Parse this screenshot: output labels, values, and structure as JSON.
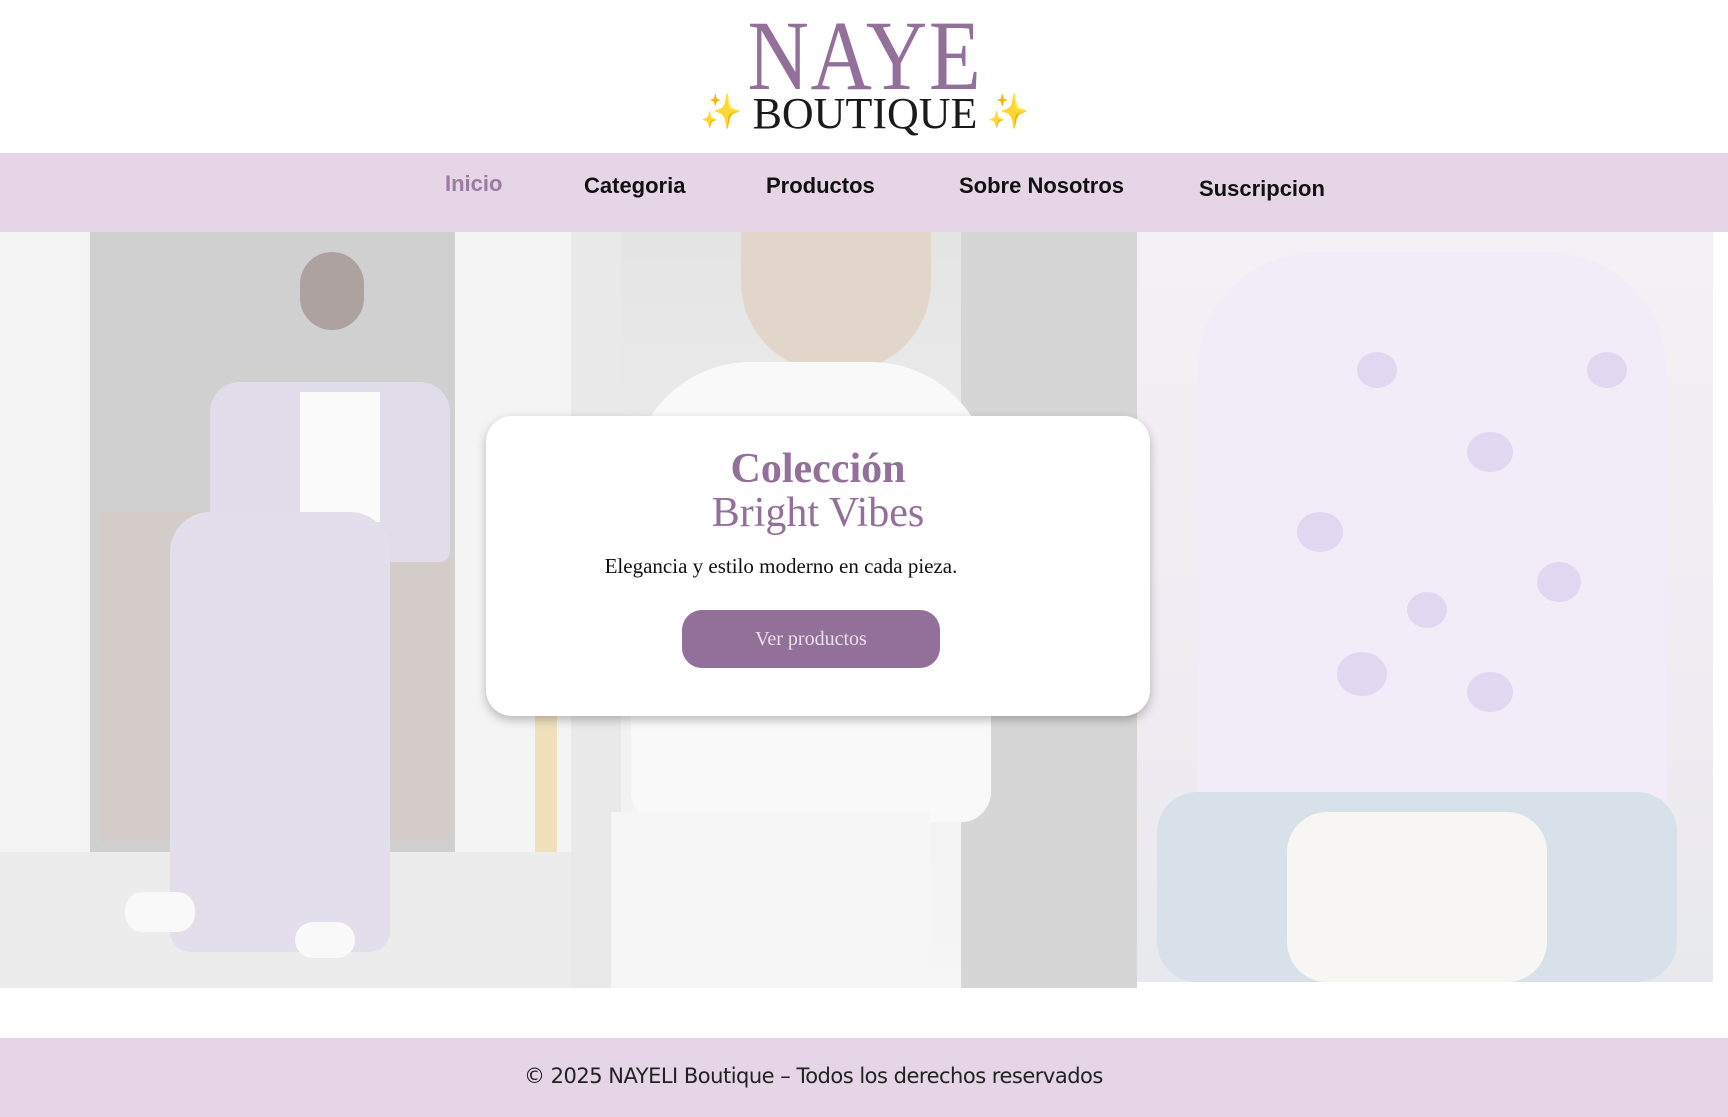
{
  "logo": {
    "name": "NAYE",
    "subtitle": "BOUTIQUE",
    "sparkle": "✨"
  },
  "nav": {
    "items": [
      {
        "label": "Inicio",
        "active": true
      },
      {
        "label": "Categoria",
        "active": false
      },
      {
        "label": "Productos",
        "active": false
      },
      {
        "label": "Sobre Nosotros",
        "active": false
      },
      {
        "label": "Suscripcion",
        "active": false
      }
    ]
  },
  "hero": {
    "title": "Colección",
    "subtitle": "Bright Vibes",
    "tagline": "Elegancia y estilo moderno en cada pieza.",
    "button_label": "Ver productos"
  },
  "footer": {
    "text": "© 2025 NAYELI Boutique – Todos los derechos reservados"
  },
  "colors": {
    "accent": "#93709a",
    "nav_background": "#e5d5e6",
    "active_nav": "#9b7ba1",
    "sparkle": "#f2c94c"
  }
}
